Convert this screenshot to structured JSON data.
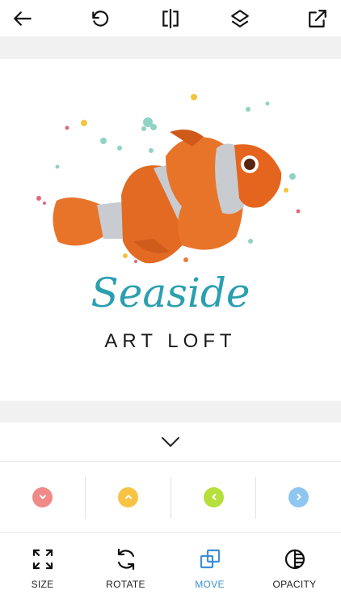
{
  "toolbar": {
    "icons": [
      "back-arrow-icon",
      "undo-icon",
      "flip-icon",
      "layers-icon",
      "share-icon"
    ]
  },
  "artwork": {
    "logo_line1": "Seaside",
    "logo_line2": "ART LOFT"
  },
  "collapse": {
    "icon": "chevron-down-icon"
  },
  "nudge": {
    "down_color": "#ef8a88",
    "up_color": "#f6c343",
    "left_color": "#b6df3b",
    "right_color": "#8ec6f2"
  },
  "tools": [
    {
      "label": "SIZE",
      "icon": "resize-icon"
    },
    {
      "label": "ROTATE",
      "icon": "rotate-icon"
    },
    {
      "label": "MOVE",
      "icon": "move-icon",
      "active": true
    },
    {
      "label": "OPACITY",
      "icon": "opacity-icon"
    }
  ],
  "colors": {
    "accent": "#3d8fd8",
    "band": "#f1f1f1"
  }
}
